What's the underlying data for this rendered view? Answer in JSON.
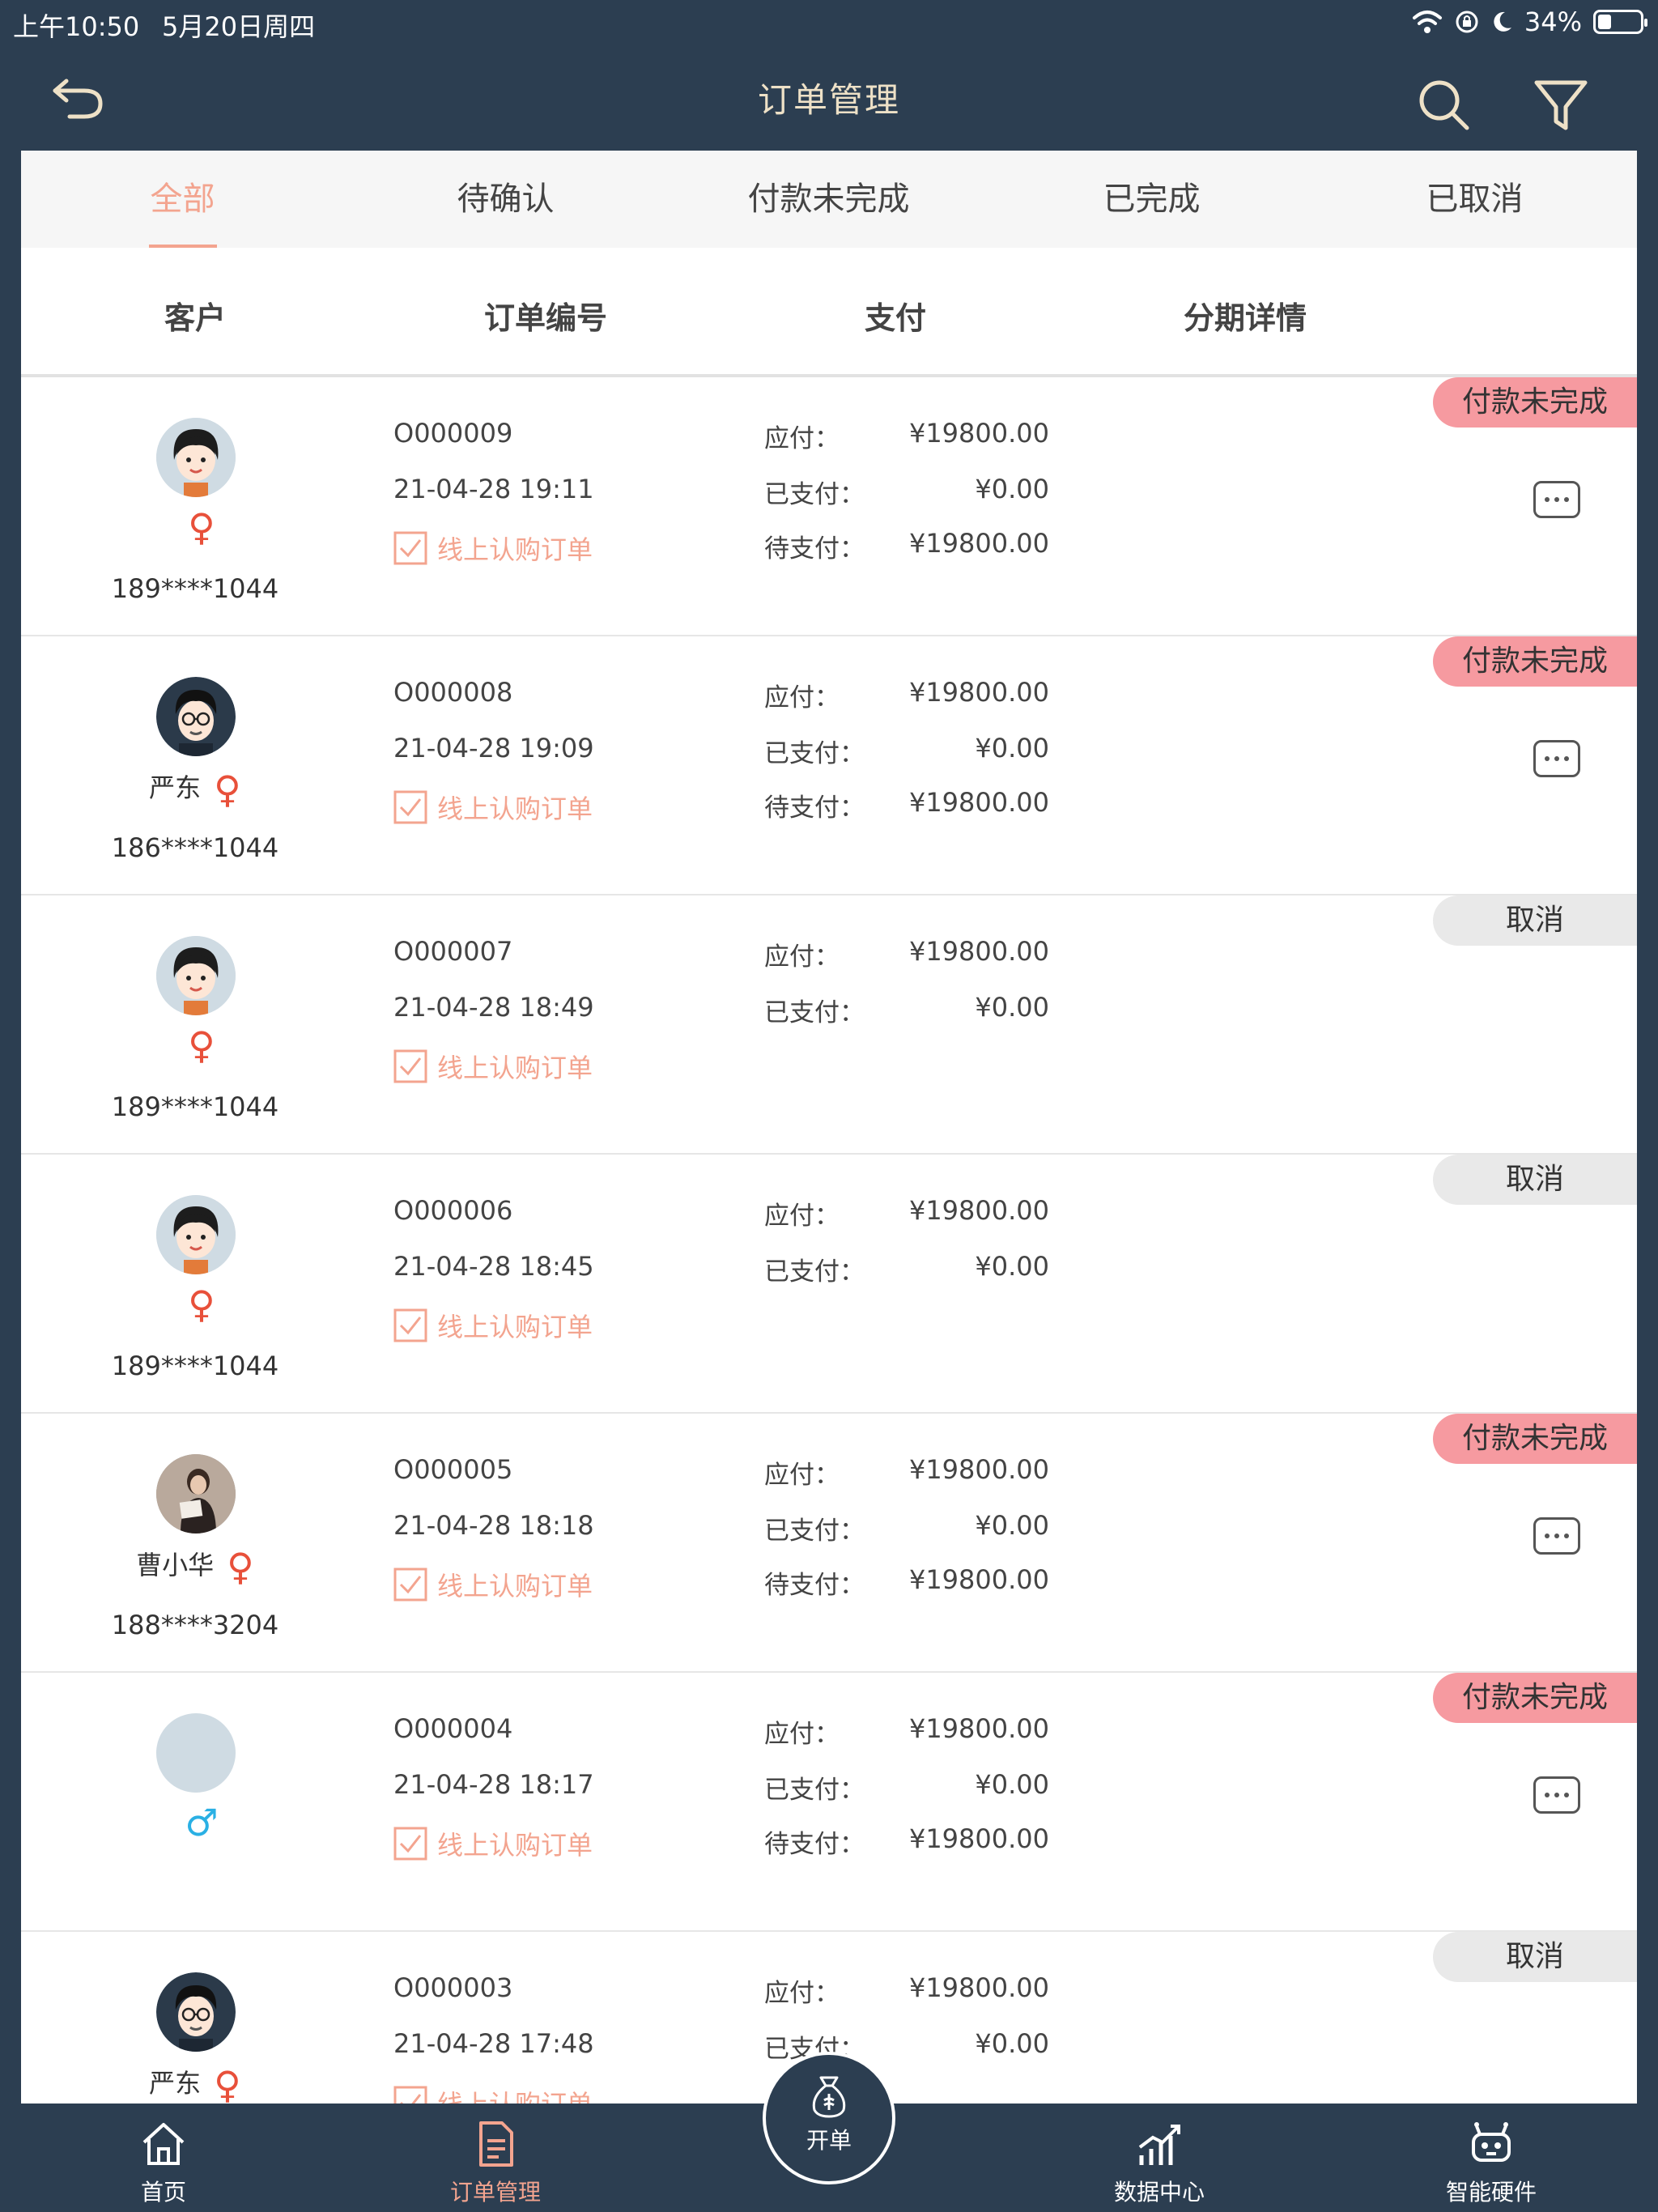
{
  "status_bar": {
    "time": "上午10:50",
    "date": "5月20日周四",
    "battery": "34%"
  },
  "nav": {
    "title": "订单管理"
  },
  "tabs": [
    "全部",
    "待确认",
    "付款未完成",
    "已完成",
    "已取消"
  ],
  "columns": [
    "客户",
    "订单编号",
    "支付",
    "分期详情"
  ],
  "labels": {
    "due": "应付：",
    "paid": "已支付：",
    "pending": "待支付："
  },
  "orders": [
    {
      "name": "",
      "gender": "♀",
      "phone": "189****1044",
      "order_no": "O000009",
      "time": "21-04-28 19:11",
      "type": "线上认购订单",
      "due": "¥19800.00",
      "paid": "¥0.00",
      "pending": "¥19800.00",
      "status": "付款未完成"
    },
    {
      "name": "严东",
      "gender": "♀",
      "phone": "186****1044",
      "order_no": "O000008",
      "time": "21-04-28 19:09",
      "type": "线上认购订单",
      "due": "¥19800.00",
      "paid": "¥0.00",
      "pending": "¥19800.00",
      "status": "付款未完成"
    },
    {
      "name": "",
      "gender": "♀",
      "phone": "189****1044",
      "order_no": "O000007",
      "time": "21-04-28 18:49",
      "type": "线上认购订单",
      "due": "¥19800.00",
      "paid": "¥0.00",
      "status": "取消"
    },
    {
      "name": "",
      "gender": "♀",
      "phone": "189****1044",
      "order_no": "O000006",
      "time": "21-04-28 18:45",
      "type": "线上认购订单",
      "due": "¥19800.00",
      "paid": "¥0.00",
      "status": "取消"
    },
    {
      "name": "曹小华",
      "gender": "♀",
      "phone": "188****3204",
      "order_no": "O000005",
      "time": "21-04-28 18:18",
      "type": "线上认购订单",
      "due": "¥19800.00",
      "paid": "¥0.00",
      "pending": "¥19800.00",
      "status": "付款未完成"
    },
    {
      "name": "",
      "gender": "♂",
      "phone": "",
      "order_no": "O000004",
      "time": "21-04-28 18:17",
      "type": "线上认购订单",
      "due": "¥19800.00",
      "paid": "¥0.00",
      "pending": "¥19800.00",
      "status": "付款未完成"
    },
    {
      "name": "严东",
      "gender": "♀",
      "phone": "",
      "order_no": "O000003",
      "time": "21-04-28 17:48",
      "type": "线上认购订单",
      "due": "¥19800.00",
      "paid": "¥0.00",
      "status": "取消"
    }
  ],
  "bottom_tabs": {
    "home": "首页",
    "orders": "订单管理",
    "new_order": "开单",
    "data": "数据中心",
    "hardware": "智能硬件"
  },
  "colors": {
    "accent": "#f3a48f",
    "nav_bg": "#2c3e51",
    "unpaid_badge": "#f69aa0",
    "cancel_badge": "#e9e9e9",
    "female": "#e8503a",
    "male": "#2ab0e4"
  }
}
